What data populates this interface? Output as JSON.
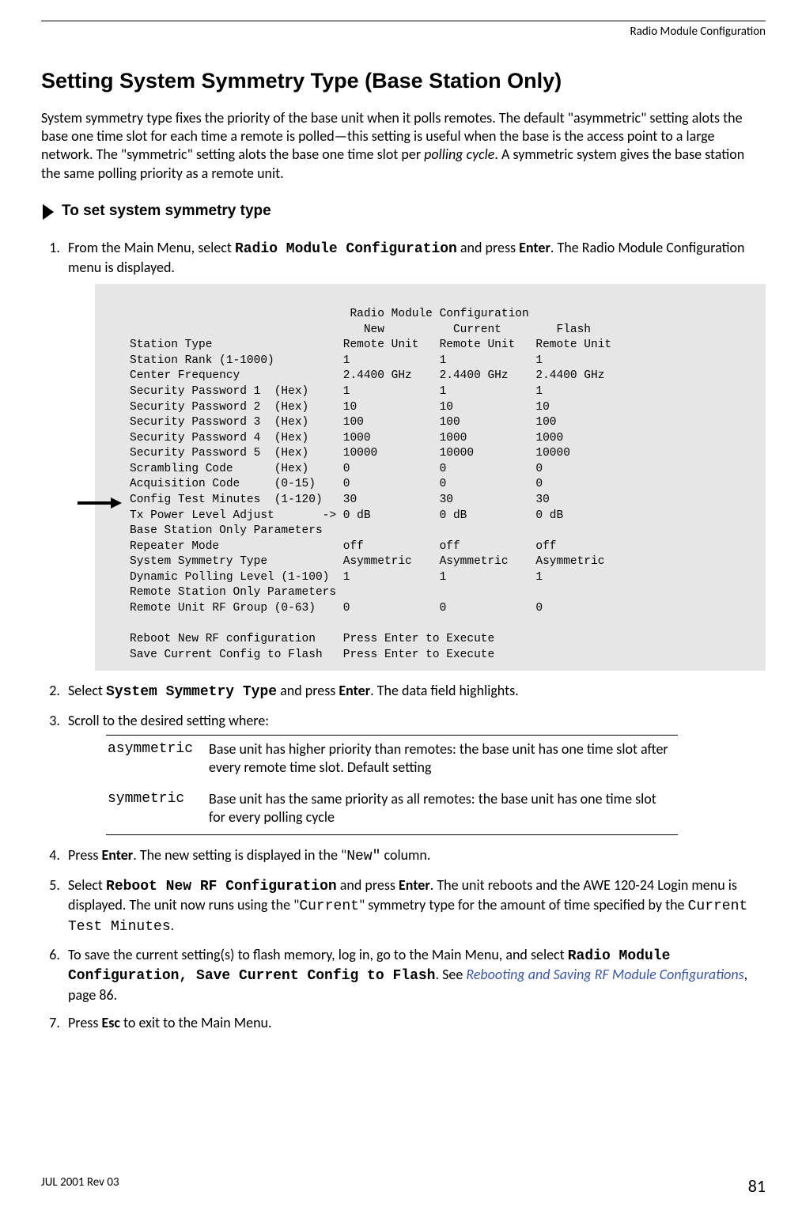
{
  "header": {
    "section_title": "Radio Module Configuration"
  },
  "heading": "Setting System Symmetry Type (Base Station Only)",
  "intro": {
    "t1": "System symmetry type fixes the priority of the base unit when it polls remotes. The default \"asymmetric\" setting alots the base one time slot for each time a remote is polled—this setting is useful when the base is the access point to a large network. The \"symmetric\" setting alots the base one time slot per ",
    "italic": "polling cycle",
    "t2": ". A symmetric system gives the base station the same polling priority as a remote unit."
  },
  "proc_heading": "To set system symmetry type",
  "steps": {
    "s1a": "From the Main Menu, select ",
    "s1m": "Radio Module Configuration",
    "s1b": " and press ",
    "s1k": "Enter",
    "s1c": ". The Radio Module Configuration menu is displayed.",
    "s2a": "Select ",
    "s2m": "System Symmetry Type",
    "s2b": " and press ",
    "s2k": "Enter",
    "s2c": ". The data field highlights.",
    "s3": "Scroll to the desired setting where:",
    "s4a": "Press ",
    "s4k": "Enter",
    "s4b": ". The new setting is displayed in the \"",
    "s4m": "New\"",
    "s4c": " column.",
    "s5a": "Select ",
    "s5m": "Reboot New RF Configuration",
    "s5b": " and press ",
    "s5k": "Enter",
    "s5c": ". The unit reboots and the AWE 120-24 Login menu is displayed. The unit now runs using the \"",
    "s5m2": "Current",
    "s5d": "\" symmetry type for the amount of time specified by the ",
    "s5m3": "Current Test Minutes",
    "s5e": ".",
    "s6a": "To save the current setting(s) to flash memory, log in, go to the Main Menu, and select ",
    "s6m": "Radio Module Configuration, Save Current Config to Flash",
    "s6b": ". See ",
    "s6l": "Rebooting and Saving RF Module Configurations",
    "s6c": ", page 86.",
    "s7a": "Press ",
    "s7k": "Esc",
    "s7b": " to exit to the Main Menu."
  },
  "defs": {
    "t1": "asymmetric",
    "d1": "Base unit has higher priority than remotes: the base unit has one time slot after every remote time slot. Default setting",
    "t2": "symmetric",
    "d2": "Base unit has the same priority as all remotes: the base unit has one time slot for every polling cycle"
  },
  "footer": {
    "rev": "JUL 2001 Rev 03",
    "page": "81"
  },
  "chart_data": {
    "type": "table",
    "title": "Radio Module Configuration",
    "columns": [
      "",
      "",
      "New",
      "Current",
      "Flash"
    ],
    "rows": [
      [
        "Station Type",
        "",
        "Remote Unit",
        "Remote Unit",
        "Remote Unit"
      ],
      [
        "Station Rank (1-1000)",
        "",
        "1",
        "1",
        "1"
      ],
      [
        "Center Frequency",
        "",
        "2.4400 GHz",
        "2.4400 GHz",
        "2.4400 GHz"
      ],
      [
        "Security Password 1",
        "(Hex)",
        "1",
        "1",
        "1"
      ],
      [
        "Security Password 2",
        "(Hex)",
        "10",
        "10",
        "10"
      ],
      [
        "Security Password 3",
        "(Hex)",
        "100",
        "100",
        "100"
      ],
      [
        "Security Password 4",
        "(Hex)",
        "1000",
        "1000",
        "1000"
      ],
      [
        "Security Password 5",
        "(Hex)",
        "10000",
        "10000",
        "10000"
      ],
      [
        "Scrambling Code",
        "(Hex)",
        "0",
        "0",
        "0"
      ],
      [
        "Acquisition Code",
        "(0-15)",
        "0",
        "0",
        "0"
      ],
      [
        "Config Test Minutes",
        "(1-120)",
        "30",
        "30",
        "30"
      ],
      [
        "Tx Power Level Adjust",
        "->",
        "0 dB",
        "0 dB",
        "0 dB"
      ],
      [
        "Base Station Only Parameters",
        "",
        "",
        "",
        ""
      ],
      [
        "Repeater Mode",
        "",
        "off",
        "off",
        "off"
      ],
      [
        "System Symmetry Type",
        "",
        "Asymmetric",
        "Asymmetric",
        "Asymmetric"
      ],
      [
        "Dynamic Polling Level (1-100)",
        "",
        "1",
        "1",
        "1"
      ],
      [
        "Remote Station Only Parameters",
        "",
        "",
        "",
        ""
      ],
      [
        "Remote Unit RF Group (0-63)",
        "",
        "0",
        "0",
        "0"
      ],
      [
        "",
        "",
        "",
        "",
        ""
      ],
      [
        "Reboot New RF configuration",
        "",
        "Press Enter to Execute",
        "",
        ""
      ],
      [
        "Save Current Config to Flash",
        "",
        "Press Enter to Execute",
        "",
        ""
      ]
    ],
    "selected_row": "Tx Power Level Adjust",
    "highlighted_row": "System Symmetry Type"
  },
  "code": "                          Radio Module Configuration\n                                  New          Current        Flash\nStation Type                   Remote Unit   Remote Unit   Remote Unit\nStation Rank (1-1000)          1             1             1\nCenter Frequency               2.4400 GHz    2.4400 GHz    2.4400 GHz\nSecurity Password 1  (Hex)     1             1             1\nSecurity Password 2  (Hex)     10            10            10\nSecurity Password 3  (Hex)     100           100           100\nSecurity Password 4  (Hex)     1000          1000          1000\nSecurity Password 5  (Hex)     10000         10000         10000\nScrambling Code      (Hex)     0             0             0\nAcquisition Code     (0-15)    0             0             0\nConfig Test Minutes  (1-120)   30            30            30\nTx Power Level Adjust       -> 0 dB          0 dB          0 dB\nBase Station Only Parameters\nRepeater Mode                  off           off           off\nSystem Symmetry Type           Asymmetric    Asymmetric    Asymmetric\nDynamic Polling Level (1-100)  1             1             1\nRemote Station Only Parameters\nRemote Unit RF Group (0-63)    0             0             0\n\nReboot New RF configuration    Press Enter to Execute\nSave Current Config to Flash   Press Enter to Execute"
}
